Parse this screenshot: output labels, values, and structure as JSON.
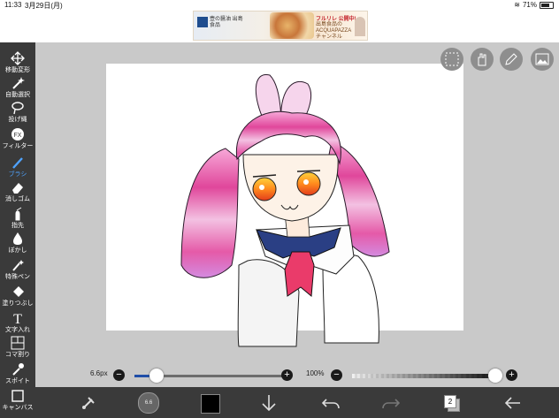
{
  "status_bar": {
    "time": "11:33",
    "date": "3月29日(月)",
    "battery": "71%"
  },
  "ad": {
    "brand": "壺の醤油 出島食品",
    "banner": "フルリレ 公開中!",
    "channel": "出島食品の ACQUAPAZZA チャンネル"
  },
  "tools": [
    {
      "label": "移動変形",
      "icon": "move-icon"
    },
    {
      "label": "自動選択",
      "icon": "magic-wand-icon"
    },
    {
      "label": "投げ縄",
      "icon": "lasso-icon"
    },
    {
      "label": "フィルター",
      "icon": "filter-fx-icon",
      "glyph": "FX"
    },
    {
      "label": "ブラシ",
      "icon": "brush-icon",
      "active": true
    },
    {
      "label": "消しゴム",
      "icon": "eraser-icon"
    },
    {
      "label": "指先",
      "icon": "finger-icon"
    },
    {
      "label": "ぼかし",
      "icon": "blur-drop-icon"
    },
    {
      "label": "特殊ペン",
      "icon": "special-pen-icon"
    },
    {
      "label": "塗りつぶし",
      "icon": "fill-bucket-icon"
    },
    {
      "label": "文字入れ",
      "icon": "text-icon",
      "glyph": "T"
    },
    {
      "label": "コマ割り",
      "icon": "frame-divide-icon"
    },
    {
      "label": "スポイト",
      "icon": "eyedropper-icon"
    },
    {
      "label": "キャンバス",
      "icon": "canvas-icon"
    }
  ],
  "sliders": {
    "brush_size": {
      "label": "6.6px",
      "minus": "−",
      "plus": "+",
      "level": 0.09
    },
    "opacity": {
      "label": "100%",
      "minus": "−",
      "plus": "+",
      "level": 1.0
    }
  },
  "bottom": {
    "brush_preview_label": "6.6",
    "layer_count": "2"
  },
  "colors": {
    "toolbar": "#3a3a3a",
    "accent": "#4fa3ff",
    "slider_fill": "#1f4ea8",
    "current_color": "#000000"
  }
}
